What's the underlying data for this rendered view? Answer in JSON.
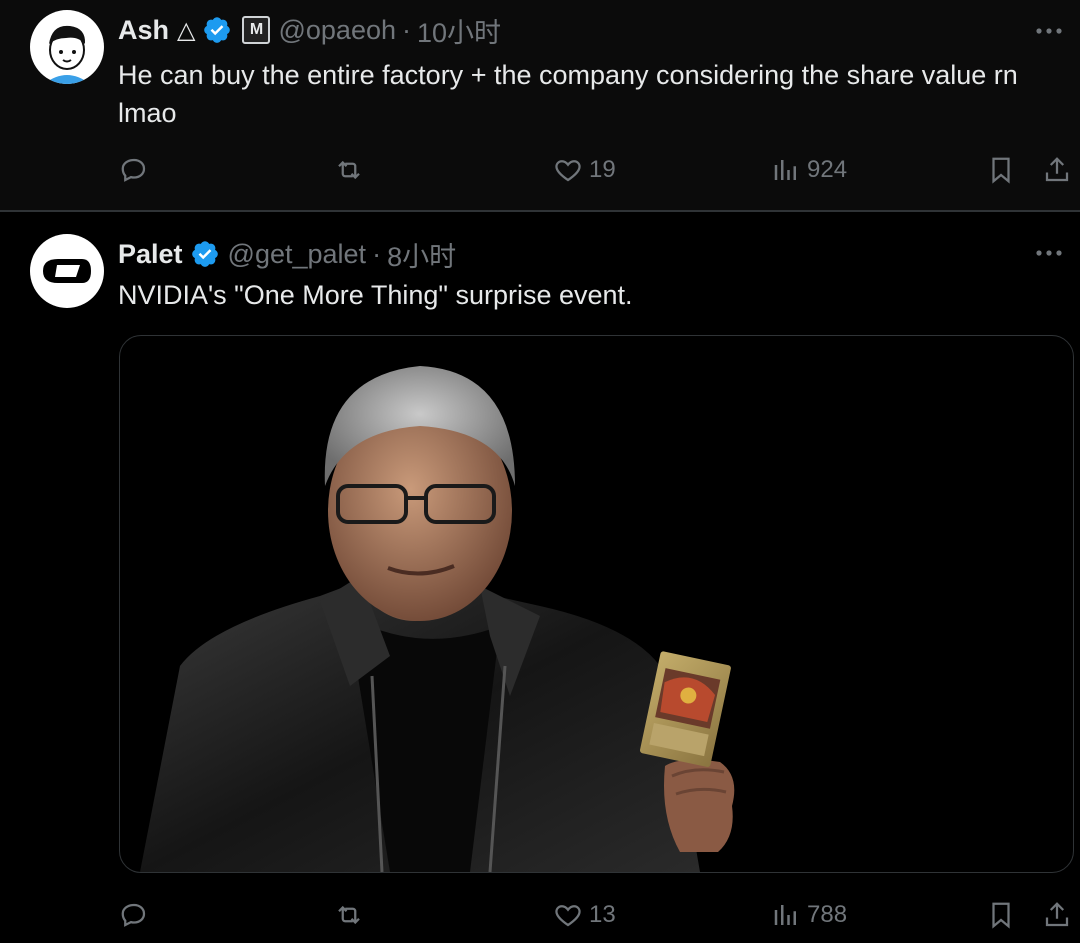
{
  "tweets": [
    {
      "name": "Ash",
      "name_glyph": "△",
      "badge_letter": "M",
      "handle": "@opaeoh",
      "separator": "·",
      "time": "10小时",
      "text": "He can buy the entire factory + the company considering the share value rn lmao",
      "likes": "19",
      "views": "924"
    },
    {
      "name": "Palet",
      "handle": "@get_palet",
      "separator": "·",
      "time": "8小时",
      "text": "NVIDIA's \"One More Thing\" surprise event.",
      "likes": "13",
      "views": "788"
    }
  ],
  "colors": {
    "background": "#000000",
    "text": "#e7e9ea",
    "muted": "#71767b",
    "verified": "#1d9bf0",
    "divider": "#2f3336"
  },
  "icons": [
    "verified-badge-icon",
    "more-icon",
    "reply-icon",
    "retweet-icon",
    "like-icon",
    "views-icon",
    "bookmark-icon",
    "share-icon"
  ]
}
